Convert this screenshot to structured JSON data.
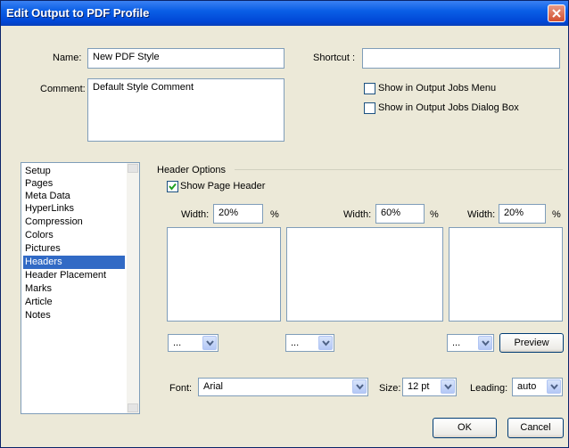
{
  "window": {
    "title": "Edit Output to PDF Profile"
  },
  "form": {
    "name_label": "Name:",
    "name_value": "New PDF Style",
    "comment_label": "Comment:",
    "comment_value": "Default Style Comment",
    "shortcut_label": "Shortcut :",
    "shortcut_value": "",
    "show_menu_label": "Show in Output Jobs Menu",
    "show_menu_checked": false,
    "show_dialog_label": "Show in Output Jobs Dialog Box",
    "show_dialog_checked": false
  },
  "sidebar": {
    "items": [
      {
        "label": "Setup"
      },
      {
        "label": "Pages"
      },
      {
        "label": "Meta Data"
      },
      {
        "label": "HyperLinks"
      },
      {
        "label": "Compression"
      },
      {
        "label": "Colors"
      },
      {
        "label": "Pictures"
      },
      {
        "label": "Headers"
      },
      {
        "label": "Header Placement"
      },
      {
        "label": "Marks"
      },
      {
        "label": "Article"
      },
      {
        "label": "Notes"
      }
    ],
    "selected": "Headers"
  },
  "header_options": {
    "group_label": "Header Options",
    "show_header_label": "Show Page Header",
    "show_header_checked": true,
    "columns": [
      {
        "width_label": "Width:",
        "width_value": "20%",
        "unit": "%",
        "combo_value": "..."
      },
      {
        "width_label": "Width:",
        "width_value": "60%",
        "unit": "%",
        "combo_value": "..."
      },
      {
        "width_label": "Width:",
        "width_value": "20%",
        "unit": "%",
        "combo_value": "..."
      }
    ],
    "preview_label": "Preview",
    "font_label": "Font:",
    "font_value": "Arial",
    "size_label": "Size:",
    "size_value": "12 pt",
    "leading_label": "Leading:",
    "leading_value": "auto"
  },
  "footer": {
    "ok_label": "OK",
    "cancel_label": "Cancel"
  },
  "colors": {
    "titlebar": "#0a5ee6",
    "selection": "#316ac5",
    "dialog_bg": "#ece9d8"
  }
}
